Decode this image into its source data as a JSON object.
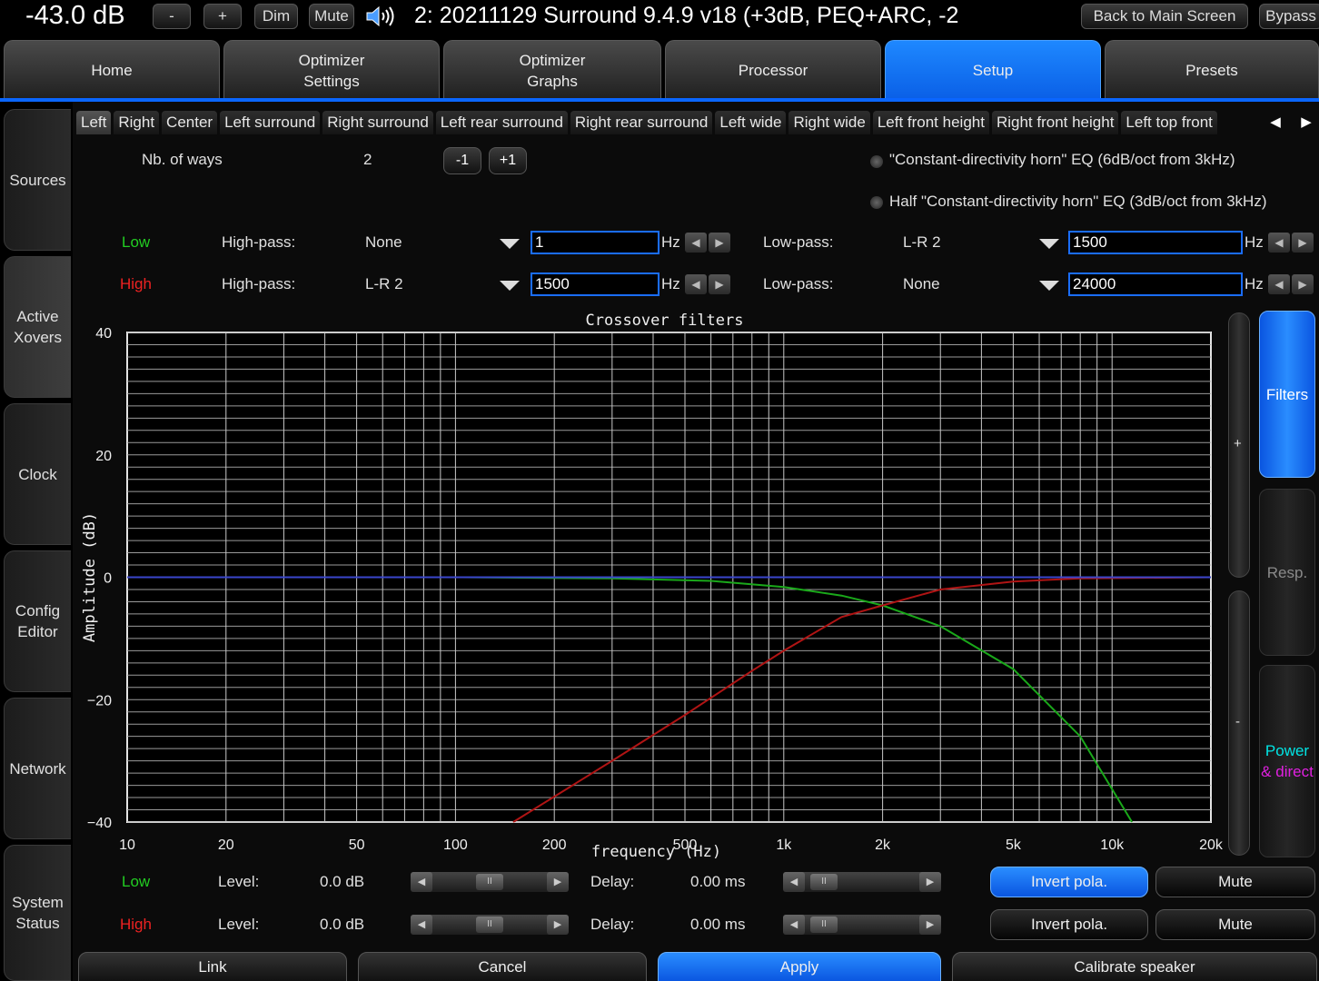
{
  "topbar": {
    "volume": "-43.0 dB",
    "minus_label": "-",
    "plus_label": "+",
    "dim_label": "Dim",
    "mute_label": "Mute",
    "preset_title": "2: 20211129 Surround 9.4.9 v18 (+3dB, PEQ+ARC, -2",
    "back_label": "Back to Main Screen",
    "bypass_label": "Bypass"
  },
  "main_tabs": [
    {
      "label": "Home"
    },
    {
      "label": "Optimizer\nSettings"
    },
    {
      "label": "Optimizer\nGraphs"
    },
    {
      "label": "Processor"
    },
    {
      "label": "Setup"
    },
    {
      "label": "Presets"
    }
  ],
  "active_main_tab": "Setup",
  "sidebar": [
    {
      "label": "Sources"
    },
    {
      "label": "Active\nXovers"
    },
    {
      "label": "Clock"
    },
    {
      "label": "Config\nEditor"
    },
    {
      "label": "Network"
    },
    {
      "label": "System\nStatus"
    }
  ],
  "channel_tabs": [
    "Left",
    "Right",
    "Center",
    "Left surround",
    "Right surround",
    "Left rear surround",
    "Right rear surround",
    "Left wide",
    "Right wide",
    "Left front height",
    "Right front height",
    "Left top front"
  ],
  "active_channel": "Left",
  "ways": {
    "label": "Nb. of ways",
    "value": "2",
    "minus": "-1",
    "plus": "+1"
  },
  "horn_eq": {
    "option1": "\"Constant-directivity horn\" EQ (6dB/oct from 3kHz)",
    "option2": "Half \"Constant-directivity horn\" EQ (3dB/oct from 3kHz)"
  },
  "bands": [
    {
      "name": "Low",
      "color": "#22cc22",
      "hp_label": "High-pass:",
      "hp_type": "None",
      "hp_freq": "1",
      "lp_label": "Low-pass:",
      "lp_type": "L-R 2",
      "lp_freq": "1500",
      "unit": "Hz"
    },
    {
      "name": "High",
      "color": "#ee2222",
      "hp_label": "High-pass:",
      "hp_type": "L-R 2",
      "hp_freq": "1500",
      "lp_label": "Low-pass:",
      "lp_type": "None",
      "lp_freq": "24000",
      "unit": "Hz"
    }
  ],
  "chart_data": {
    "type": "line",
    "title": "Crossover filters",
    "xlabel": "frequency (Hz)",
    "ylabel": "Amplitude (dB)",
    "x_scale": "log",
    "xlim": [
      10,
      20000
    ],
    "ylim": [
      -40,
      40
    ],
    "x_ticks": [
      10,
      20,
      50,
      100,
      200,
      500,
      1000,
      2000,
      5000,
      10000,
      20000
    ],
    "x_tick_labels": [
      "10",
      "20",
      "50",
      "100",
      "200",
      "500",
      "1k",
      "2k",
      "5k",
      "10k",
      "20k"
    ],
    "y_ticks": [
      -40,
      -20,
      0,
      20,
      40
    ],
    "y_tick_labels": [
      "−40",
      "−20",
      "0",
      "20",
      "40"
    ],
    "grid": true,
    "series": [
      {
        "color": "#1aa81a",
        "x": [
          10,
          100,
          300,
          600,
          1000,
          1500,
          2000,
          3000,
          5000,
          8000,
          11500
        ],
        "values": [
          0,
          0,
          -0.2,
          -0.6,
          -1.6,
          -3.0,
          -4.6,
          -8.0,
          -15.0,
          -26.0,
          -40.0
        ]
      },
      {
        "color": "#b01414",
        "x": [
          150,
          300,
          500,
          800,
          1000,
          1500,
          2000,
          3000,
          5000,
          8000,
          20000
        ],
        "values": [
          -40.0,
          -30.0,
          -22.5,
          -15.3,
          -12.0,
          -6.5,
          -4.6,
          -2.0,
          -0.7,
          -0.2,
          0
        ]
      },
      {
        "color": "#3a46cc",
        "x": [
          10,
          20000
        ],
        "values": [
          0,
          0
        ]
      }
    ]
  },
  "right_buttons": [
    {
      "label": "Filters",
      "color": "#ffffff",
      "on": true
    },
    {
      "label": "Resp.",
      "color": "#8a8a8a",
      "on": false
    },
    {
      "label_a": "Power",
      "label_b": "& direct",
      "color_a": "#00e5e5",
      "color_b": "#e020e0",
      "on": false
    }
  ],
  "scroll_plus": "+",
  "scroll_minus": "-",
  "band_controls": [
    {
      "name": "Low",
      "color": "#22cc22",
      "level_label": "Level:",
      "level": "0.0 dB",
      "delay_label": "Delay:",
      "delay": "0.00 ms",
      "invert_label": "Invert pola.",
      "invert_on": true,
      "mute_label": "Mute"
    },
    {
      "name": "High",
      "color": "#ee2222",
      "level_label": "Level:",
      "level": "0.0 dB",
      "delay_label": "Delay:",
      "delay": "0.00 ms",
      "invert_label": "Invert pola.",
      "invert_on": false,
      "mute_label": "Mute"
    }
  ],
  "footer": [
    {
      "label": "Link",
      "on": false
    },
    {
      "label": "Cancel",
      "on": false
    },
    {
      "label": "Apply",
      "on": true
    },
    {
      "label": "Calibrate speaker",
      "on": false
    }
  ]
}
